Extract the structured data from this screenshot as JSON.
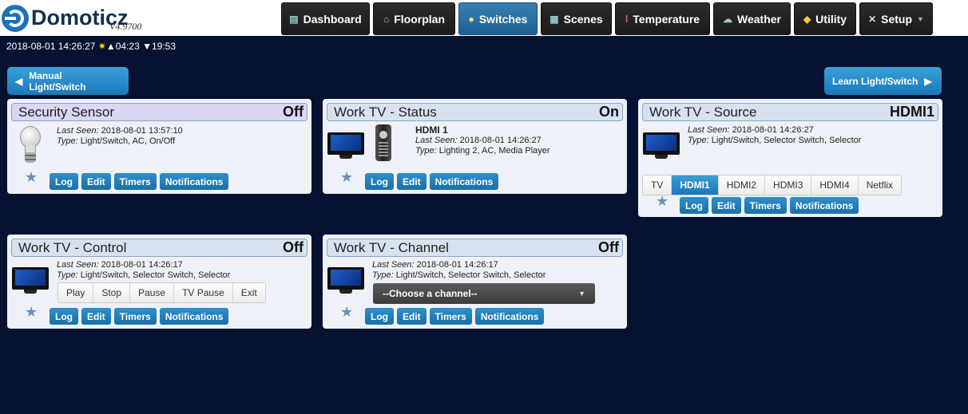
{
  "app": {
    "name": "Domoticz",
    "version": "V4.9700"
  },
  "nav": {
    "tabs": [
      {
        "label": "Dashboard",
        "icon": "dashboard-icon"
      },
      {
        "label": "Floorplan",
        "icon": "floorplan-icon"
      },
      {
        "label": "Switches",
        "icon": "bulb-icon",
        "active": true
      },
      {
        "label": "Scenes",
        "icon": "clapper-icon"
      },
      {
        "label": "Temperature",
        "icon": "thermometer-icon"
      },
      {
        "label": "Weather",
        "icon": "cloud-icon"
      },
      {
        "label": "Utility",
        "icon": "utility-icon"
      },
      {
        "label": "Setup",
        "icon": "wrench-icon",
        "dropdown": true
      }
    ]
  },
  "status": {
    "datetime": "2018-08-01 14:26:27",
    "sunrise": "04:23",
    "sunset": "19:53"
  },
  "actions": {
    "manual": "Manual Light/Switch",
    "learn": "Learn Light/Switch"
  },
  "labels": {
    "last_seen": "Last Seen:",
    "type": "Type:"
  },
  "buttons": {
    "log": "Log",
    "edit": "Edit",
    "timers": "Timers",
    "notifications": "Notifications"
  },
  "cards": {
    "security": {
      "title": "Security Sensor",
      "state": "Off",
      "last_seen": "2018-08-01 13:57:10",
      "type": "Light/Switch, AC, On/Off"
    },
    "status": {
      "title": "Work TV - Status",
      "state": "On",
      "value": "HDMI 1",
      "last_seen": "2018-08-01 14:26:27",
      "type": "Lighting 2, AC, Media Player"
    },
    "source": {
      "title": "Work TV - Source",
      "state": "HDMI1",
      "last_seen": "2018-08-01 14:26:27",
      "type": "Light/Switch, Selector Switch, Selector",
      "levels": [
        "TV",
        "HDMI1",
        "HDMI2",
        "HDMI3",
        "HDMI4",
        "Netflix"
      ]
    },
    "control": {
      "title": "Work TV - Control",
      "state": "Off",
      "last_seen": "2018-08-01 14:26:17",
      "type": "Light/Switch, Selector Switch, Selector",
      "levels": [
        "Play",
        "Stop",
        "Pause",
        "TV Pause",
        "Exit"
      ]
    },
    "channel": {
      "title": "Work TV - Channel",
      "state": "Off",
      "last_seen": "2018-08-01 14:26:17",
      "type": "Light/Switch, Selector Switch, Selector",
      "placeholder": "--Choose a channel--"
    }
  }
}
